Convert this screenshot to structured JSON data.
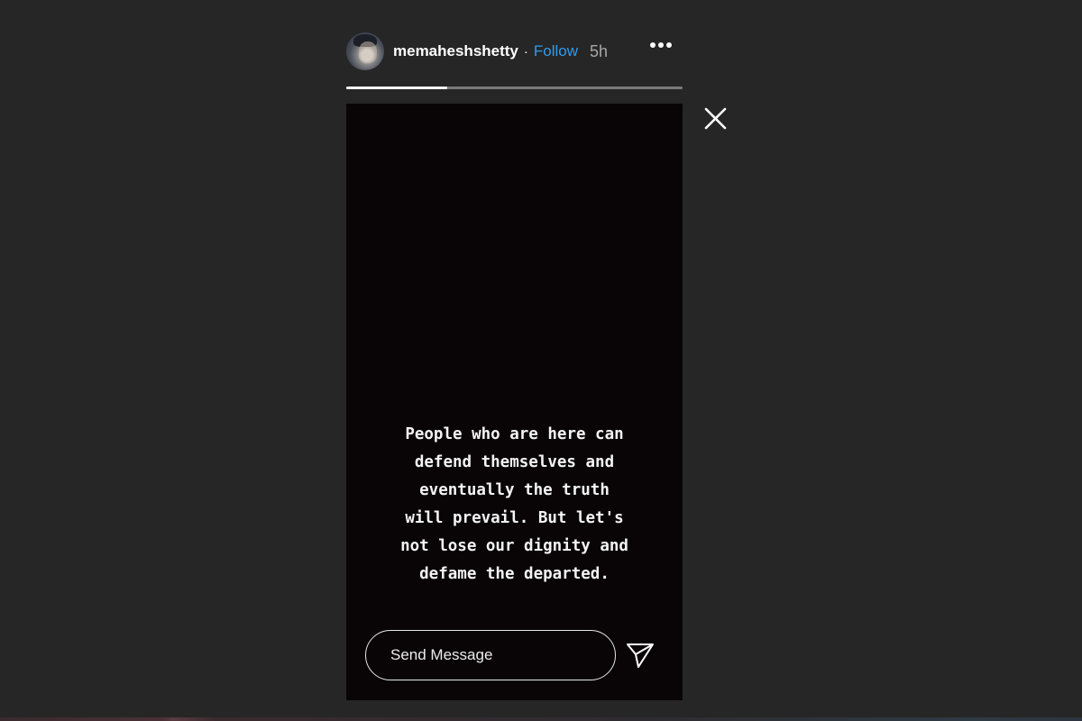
{
  "header": {
    "username": "memaheshshetty",
    "separator": "·",
    "follow_label": "Follow",
    "time_ago": "5h",
    "more_icon": "more-horizontal-icon"
  },
  "progress": {
    "segment_fill_fraction": 0.3
  },
  "close_icon": "close-icon",
  "story": {
    "text": "People who are here can\ndefend themselves and\neventually the truth\nwill prevail. But let's\nnot lose our dignity and\ndefame the departed."
  },
  "reply": {
    "placeholder": "Send Message",
    "send_icon": "send-icon"
  },
  "colors": {
    "background": "#262626",
    "story_background": "#090506",
    "follow": "#2d9cf0",
    "timestamp": "#a8a8a8",
    "progress_track": "#7a7a7a",
    "progress_fill": "#ffffff"
  }
}
